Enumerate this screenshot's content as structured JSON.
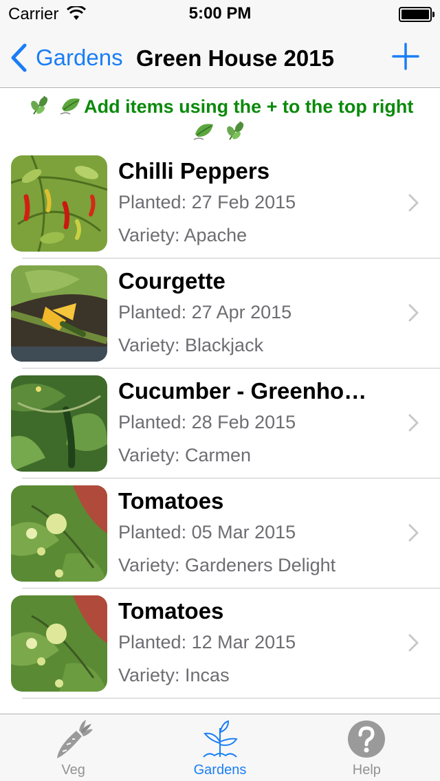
{
  "status_bar": {
    "carrier": "Carrier",
    "time": "5:00 PM"
  },
  "nav": {
    "back_label": "Gardens",
    "title": "Green House 2015",
    "add_icon": "plus-icon",
    "accent_color": "#1a7ef5"
  },
  "hint": {
    "text": "Add items using the + to the top right",
    "color": "#0b8a0b"
  },
  "plants": [
    {
      "name": "Chilli Peppers",
      "planted": "Planted: 27 Feb 2015",
      "variety": "Variety: Apache",
      "image": "chilli-peppers-photo"
    },
    {
      "name": "Courgette",
      "planted": "Planted: 27 Apr 2015",
      "variety": "Variety: Blackjack",
      "image": "courgette-photo"
    },
    {
      "name": "Cucumber - Greenho…",
      "planted": "Planted: 28 Feb 2015",
      "variety": "Variety: Carmen",
      "image": "cucumber-photo"
    },
    {
      "name": "Tomatoes",
      "planted": "Planted: 05 Mar 2015",
      "variety": "Variety: Gardeners Delight",
      "image": "tomatoes-photo"
    },
    {
      "name": "Tomatoes",
      "planted": "Planted: 12 Mar 2015",
      "variety": "Variety: Incas",
      "image": "tomatoes-photo"
    }
  ],
  "tabs": [
    {
      "label": "Veg",
      "icon": "carrot-icon",
      "active": false
    },
    {
      "label": "Gardens",
      "icon": "seedling-icon",
      "active": true
    },
    {
      "label": "Help",
      "icon": "help-icon",
      "active": false
    }
  ]
}
